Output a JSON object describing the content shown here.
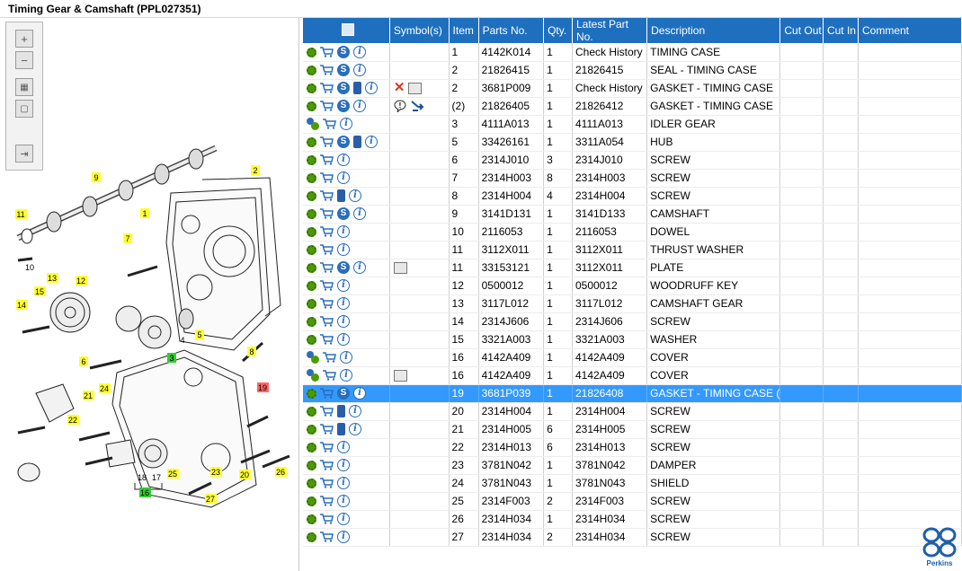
{
  "window": {
    "title": "Timing Gear & Camshaft (PPL027351)"
  },
  "zoom_toolbar": {
    "buttons": [
      "zoom-in",
      "zoom-out",
      "fit-all",
      "fit-window",
      "export"
    ]
  },
  "diagram": {
    "callouts": [
      "1",
      "2",
      "3",
      "4",
      "5",
      "6",
      "7",
      "8",
      "9",
      "10",
      "11",
      "12",
      "13",
      "14",
      "15",
      "16",
      "17",
      "18",
      "19",
      "20",
      "21",
      "22",
      "23",
      "24",
      "25",
      "26",
      "27"
    ],
    "highlighted_green": [
      "3",
      "16"
    ],
    "highlighted_red": [
      "19"
    ]
  },
  "grid": {
    "columns": [
      "",
      "Symbol(s)",
      "Item",
      "Parts No.",
      "Qty.",
      "Latest Part No.",
      "Description",
      "Cut Out",
      "Cut In",
      "Comment"
    ],
    "rows": [
      {
        "icons": [
          "gear",
          "cart",
          "s",
          "info"
        ],
        "sym": [],
        "item": "1",
        "part": "4142K014",
        "qty": "1",
        "latest": "Check History",
        "desc": "TIMING CASE",
        "cutout": "",
        "cutin": "",
        "comment": ""
      },
      {
        "icons": [
          "gear",
          "cart",
          "s",
          "info"
        ],
        "sym": [],
        "item": "2",
        "part": "21826415",
        "qty": "1",
        "latest": "21826415",
        "desc": "SEAL - TIMING CASE",
        "cutout": "",
        "cutin": "",
        "comment": ""
      },
      {
        "icons": [
          "gear",
          "cart",
          "s",
          "book",
          "info"
        ],
        "sym": [
          "x",
          "zoom"
        ],
        "item": "2",
        "part": "3681P009",
        "qty": "1",
        "latest": "Check History",
        "desc": "GASKET - TIMING CASE",
        "cutout": "",
        "cutin": "",
        "comment": ""
      },
      {
        "icons": [
          "gear",
          "cart",
          "s",
          "info"
        ],
        "sym": [
          "balloon",
          "arrow"
        ],
        "item": "(2)",
        "part": "21826405",
        "qty": "1",
        "latest": "21826412",
        "desc": "GASKET - TIMING CASE",
        "cutout": "",
        "cutin": "",
        "comment": ""
      },
      {
        "icons": [
          "gears",
          "cart",
          "info"
        ],
        "sym": [],
        "item": "3",
        "part": "4111A013",
        "qty": "1",
        "latest": "4111A013",
        "desc": "IDLER GEAR",
        "cutout": "",
        "cutin": "",
        "comment": ""
      },
      {
        "icons": [
          "gear",
          "cart",
          "s",
          "book",
          "info"
        ],
        "sym": [],
        "item": "5",
        "part": "33426161",
        "qty": "1",
        "latest": "3311A054",
        "desc": "HUB",
        "cutout": "",
        "cutin": "",
        "comment": ""
      },
      {
        "icons": [
          "gear",
          "cart",
          "info"
        ],
        "sym": [],
        "item": "6",
        "part": "2314J010",
        "qty": "3",
        "latest": "2314J010",
        "desc": "SCREW",
        "cutout": "",
        "cutin": "",
        "comment": ""
      },
      {
        "icons": [
          "gear",
          "cart",
          "info"
        ],
        "sym": [],
        "item": "7",
        "part": "2314H003",
        "qty": "8",
        "latest": "2314H003",
        "desc": "SCREW",
        "cutout": "",
        "cutin": "",
        "comment": ""
      },
      {
        "icons": [
          "gear",
          "cart",
          "book",
          "info"
        ],
        "sym": [],
        "item": "8",
        "part": "2314H004",
        "qty": "4",
        "latest": "2314H004",
        "desc": "SCREW",
        "cutout": "",
        "cutin": "",
        "comment": ""
      },
      {
        "icons": [
          "gear",
          "cart",
          "s",
          "info"
        ],
        "sym": [],
        "item": "9",
        "part": "3141D131",
        "qty": "1",
        "latest": "3141D133",
        "desc": "CAMSHAFT",
        "cutout": "",
        "cutin": "",
        "comment": ""
      },
      {
        "icons": [
          "gear",
          "cart",
          "info"
        ],
        "sym": [],
        "item": "10",
        "part": "2116053",
        "qty": "1",
        "latest": "2116053",
        "desc": "DOWEL",
        "cutout": "",
        "cutin": "",
        "comment": ""
      },
      {
        "icons": [
          "gear",
          "cart",
          "info"
        ],
        "sym": [],
        "item": "11",
        "part": "3112X011",
        "qty": "1",
        "latest": "3112X011",
        "desc": "THRUST WASHER",
        "cutout": "",
        "cutin": "",
        "comment": ""
      },
      {
        "icons": [
          "gear",
          "cart",
          "s",
          "info"
        ],
        "sym": [
          "zoom"
        ],
        "item": "11",
        "part": "33153121",
        "qty": "1",
        "latest": "3112X011",
        "desc": "PLATE",
        "cutout": "",
        "cutin": "",
        "comment": ""
      },
      {
        "icons": [
          "gear",
          "cart",
          "info"
        ],
        "sym": [],
        "item": "12",
        "part": "0500012",
        "qty": "1",
        "latest": "0500012",
        "desc": "WOODRUFF KEY",
        "cutout": "",
        "cutin": "",
        "comment": ""
      },
      {
        "icons": [
          "gear",
          "cart",
          "info"
        ],
        "sym": [],
        "item": "13",
        "part": "3117L012",
        "qty": "1",
        "latest": "3117L012",
        "desc": "CAMSHAFT GEAR",
        "cutout": "",
        "cutin": "",
        "comment": ""
      },
      {
        "icons": [
          "gear",
          "cart",
          "info"
        ],
        "sym": [],
        "item": "14",
        "part": "2314J606",
        "qty": "1",
        "latest": "2314J606",
        "desc": "SCREW",
        "cutout": "",
        "cutin": "",
        "comment": ""
      },
      {
        "icons": [
          "gear",
          "cart",
          "info"
        ],
        "sym": [],
        "item": "15",
        "part": "3321A003",
        "qty": "1",
        "latest": "3321A003",
        "desc": "WASHER",
        "cutout": "",
        "cutin": "",
        "comment": ""
      },
      {
        "icons": [
          "gears",
          "cart",
          "info"
        ],
        "sym": [],
        "item": "16",
        "part": "4142A409",
        "qty": "1",
        "latest": "4142A409",
        "desc": "COVER",
        "cutout": "",
        "cutin": "",
        "comment": ""
      },
      {
        "icons": [
          "gears",
          "cart",
          "info"
        ],
        "sym": [
          "zoom"
        ],
        "item": "16",
        "part": "4142A409",
        "qty": "1",
        "latest": "4142A409",
        "desc": "COVER",
        "cutout": "",
        "cutin": "",
        "comment": ""
      },
      {
        "icons": [
          "gear",
          "cart",
          "s",
          "info"
        ],
        "sym": [],
        "item": "19",
        "part": "3681P039",
        "qty": "1",
        "latest": "21826408",
        "desc": "GASKET - TIMING CASE (",
        "cutout": "",
        "cutin": "",
        "comment": "",
        "selected": true
      },
      {
        "icons": [
          "gear",
          "cart",
          "book",
          "info"
        ],
        "sym": [],
        "item": "20",
        "part": "2314H004",
        "qty": "1",
        "latest": "2314H004",
        "desc": "SCREW",
        "cutout": "",
        "cutin": "",
        "comment": ""
      },
      {
        "icons": [
          "gear",
          "cart",
          "book",
          "info"
        ],
        "sym": [],
        "item": "21",
        "part": "2314H005",
        "qty": "6",
        "latest": "2314H005",
        "desc": "SCREW",
        "cutout": "",
        "cutin": "",
        "comment": ""
      },
      {
        "icons": [
          "gear",
          "cart",
          "info"
        ],
        "sym": [],
        "item": "22",
        "part": "2314H013",
        "qty": "6",
        "latest": "2314H013",
        "desc": "SCREW",
        "cutout": "",
        "cutin": "",
        "comment": ""
      },
      {
        "icons": [
          "gear",
          "cart",
          "info"
        ],
        "sym": [],
        "item": "23",
        "part": "3781N042",
        "qty": "1",
        "latest": "3781N042",
        "desc": "DAMPER",
        "cutout": "",
        "cutin": "",
        "comment": ""
      },
      {
        "icons": [
          "gear",
          "cart",
          "info"
        ],
        "sym": [],
        "item": "24",
        "part": "3781N043",
        "qty": "1",
        "latest": "3781N043",
        "desc": "SHIELD",
        "cutout": "",
        "cutin": "",
        "comment": ""
      },
      {
        "icons": [
          "gear",
          "cart",
          "info"
        ],
        "sym": [],
        "item": "25",
        "part": "2314F003",
        "qty": "2",
        "latest": "2314F003",
        "desc": "SCREW",
        "cutout": "",
        "cutin": "",
        "comment": ""
      },
      {
        "icons": [
          "gear",
          "cart",
          "info"
        ],
        "sym": [],
        "item": "26",
        "part": "2314H034",
        "qty": "1",
        "latest": "2314H034",
        "desc": "SCREW",
        "cutout": "",
        "cutin": "",
        "comment": ""
      },
      {
        "icons": [
          "gear",
          "cart",
          "info"
        ],
        "sym": [],
        "item": "27",
        "part": "2314H034",
        "qty": "2",
        "latest": "2314H034",
        "desc": "SCREW",
        "cutout": "",
        "cutin": "",
        "comment": ""
      }
    ]
  },
  "brand": {
    "name": "Perkins",
    "color": "#1f5fa8"
  },
  "colors": {
    "header": "#1f6fbf",
    "selected_row": "#3399ff",
    "callout_yellow": "#ffff33",
    "callout_green": "#33cc33",
    "callout_red": "#ff6666"
  }
}
